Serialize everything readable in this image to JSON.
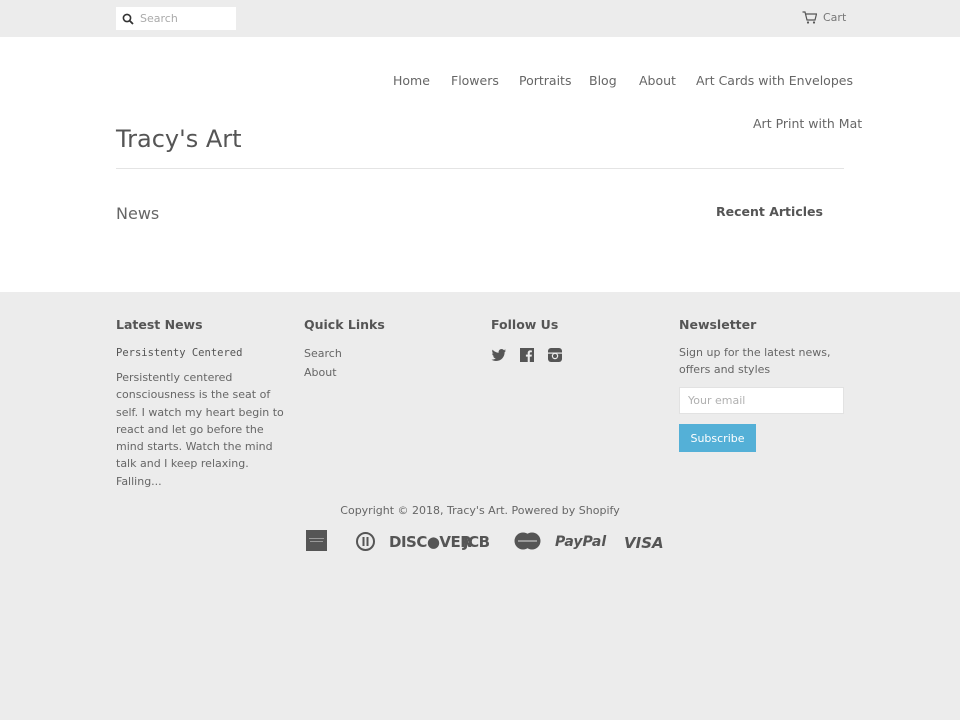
{
  "topbar": {
    "search_placeholder": "Search",
    "cart_label": "Cart"
  },
  "header": {
    "site_title": "Tracy's Art",
    "nav": [
      {
        "label": "Home"
      },
      {
        "label": "Flowers"
      },
      {
        "label": "Portraits"
      },
      {
        "label": "Blog"
      },
      {
        "label": "About"
      },
      {
        "label": "Art Cards with Envelopes"
      },
      {
        "label": "Art Print with Mat"
      }
    ]
  },
  "main": {
    "page_title": "News",
    "sidebar_title": "Recent Articles"
  },
  "footer": {
    "latest_news": {
      "heading": "Latest News",
      "article_title": "Persistenty Centered",
      "excerpt": "Persistently centered consciousness is the seat of self. I watch my heart begin to react and let go before the mind starts. Watch the mind talk and I keep relaxing. Falling..."
    },
    "quick_links": {
      "heading": "Quick Links",
      "links": [
        {
          "label": "Search"
        },
        {
          "label": "About"
        }
      ]
    },
    "follow_us": {
      "heading": "Follow Us",
      "icons": [
        "twitter-icon",
        "facebook-icon",
        "instagram-icon"
      ]
    },
    "newsletter": {
      "heading": "Newsletter",
      "text": "Sign up for the latest news, offers and styles",
      "email_placeholder": "Your email",
      "button_label": "Subscribe"
    },
    "copyright": "Copyright © 2018, Tracy's Art. Powered by Shopify",
    "payment_icons": {
      "diners": "⓪",
      "discover": "DISC●VER",
      "jcb": "JCB",
      "paypal": "PayPal",
      "visa": "VISA"
    }
  },
  "colors": {
    "accent": "#54b0d7",
    "background": "#ececec",
    "text": "#555555"
  }
}
